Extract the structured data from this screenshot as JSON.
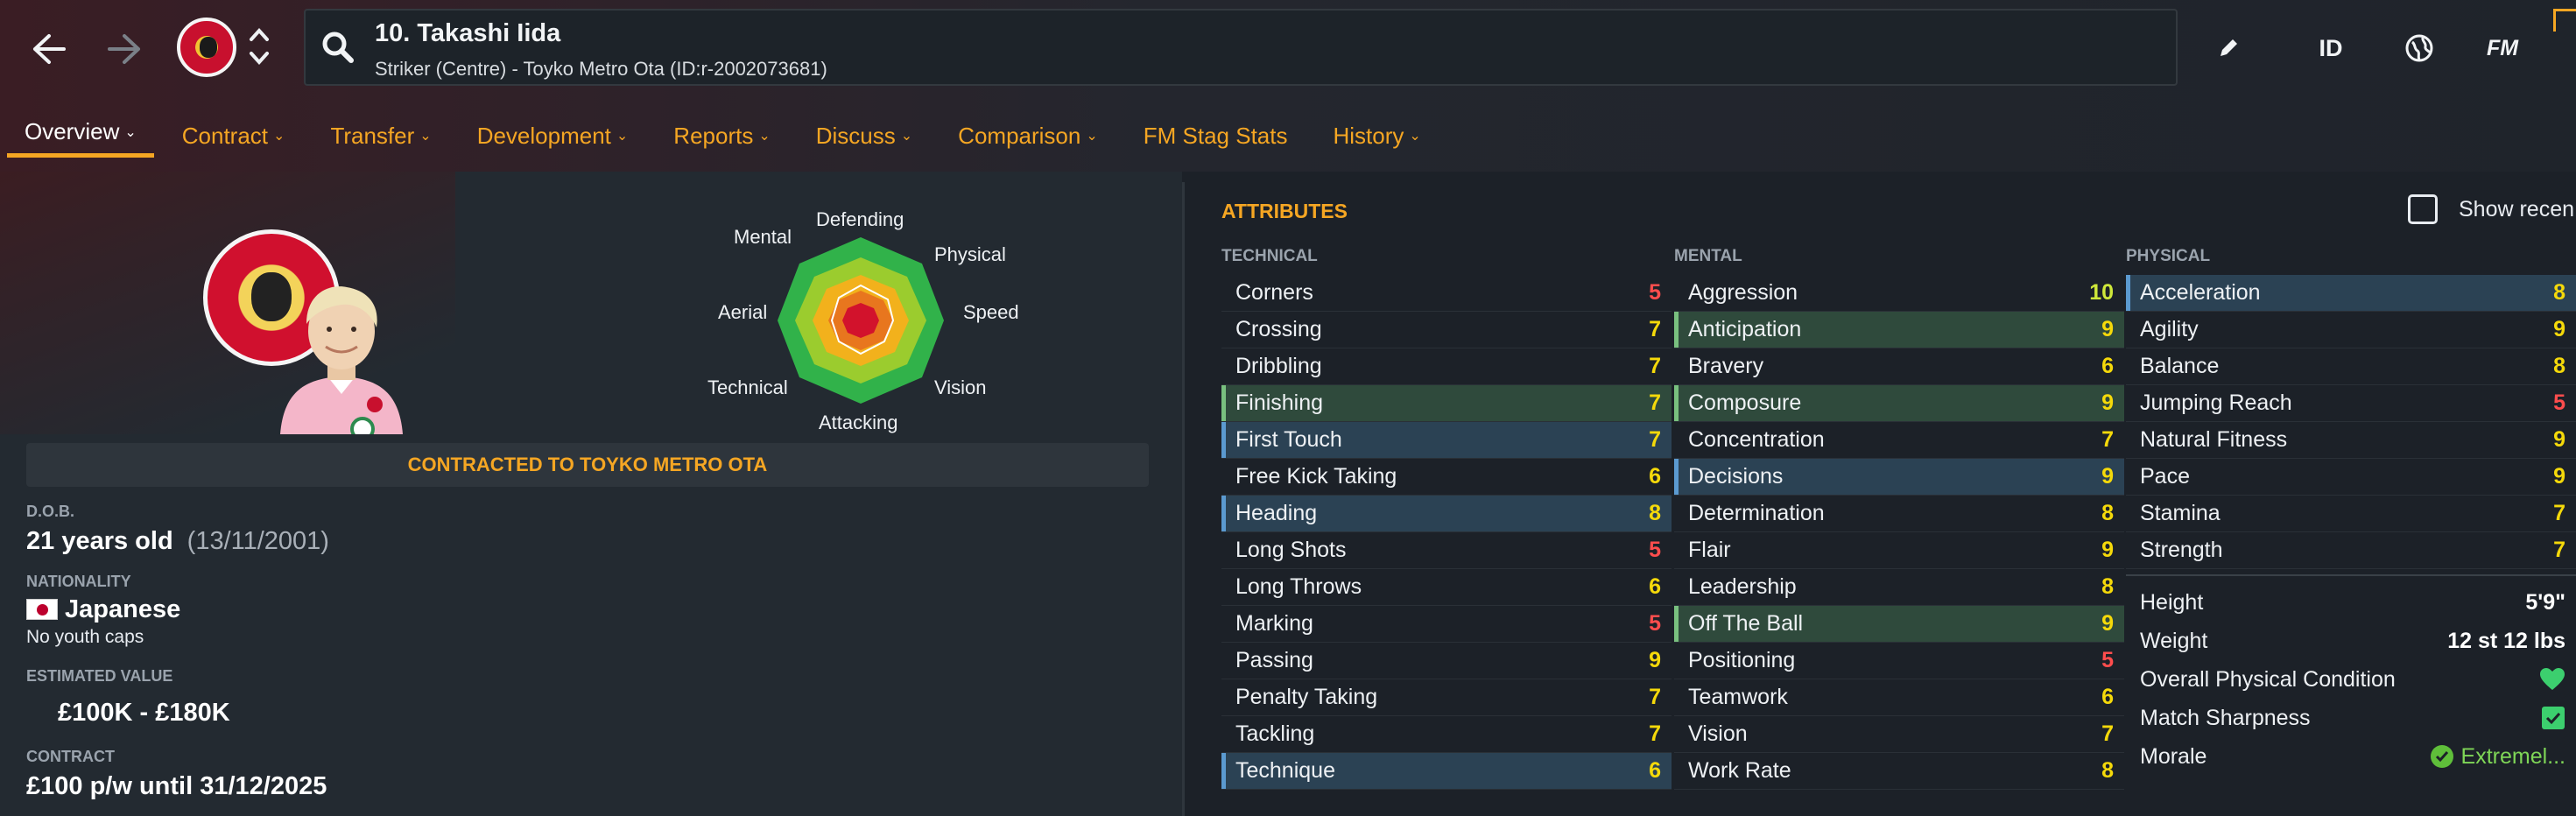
{
  "header": {
    "player_name": "10. Takashi Iida",
    "player_subtitle": "Striker (Centre) - Toyko Metro Ota (ID:r-2002073681)",
    "id_label": "ID",
    "fm_label": "FM",
    "icons": [
      "back-arrow-icon",
      "forward-arrow-icon",
      "search-icon",
      "pencil-icon",
      "globe-icon"
    ]
  },
  "tabs": [
    {
      "label": "Overview",
      "dropdown": true
    },
    {
      "label": "Contract",
      "dropdown": true
    },
    {
      "label": "Transfer",
      "dropdown": true
    },
    {
      "label": "Development",
      "dropdown": true
    },
    {
      "label": "Reports",
      "dropdown": true
    },
    {
      "label": "Discuss",
      "dropdown": true
    },
    {
      "label": "Comparison",
      "dropdown": true
    },
    {
      "label": "FM Stag Stats",
      "dropdown": false
    },
    {
      "label": "History",
      "dropdown": true
    }
  ],
  "radar": {
    "labels": {
      "defending": "Defending",
      "physical": "Physical",
      "speed": "Speed",
      "vision": "Vision",
      "attacking": "Attacking",
      "technical": "Technical",
      "aerial": "Aerial",
      "mental": "Mental"
    }
  },
  "profile": {
    "contract_banner": "CONTRACTED TO TOYKO METRO OTA",
    "dob_label": "D.O.B.",
    "age": "21 years old",
    "dob": "(13/11/2001)",
    "nationality_label": "NATIONALITY",
    "nationality": "Japanese",
    "youth_caps": "No youth caps",
    "value_label": "ESTIMATED VALUE",
    "value": "£100K - £180K",
    "contract_label": "CONTRACT",
    "contract": "£100 p/w until 31/12/2025"
  },
  "attributes": {
    "title": "ATTRIBUTES",
    "show_recent": "Show recen",
    "technical": {
      "title": "TECHNICAL",
      "items": [
        {
          "name": "Corners",
          "value": "5"
        },
        {
          "name": "Crossing",
          "value": "7"
        },
        {
          "name": "Dribbling",
          "value": "7"
        },
        {
          "name": "Finishing",
          "value": "7"
        },
        {
          "name": "First Touch",
          "value": "7"
        },
        {
          "name": "Free Kick Taking",
          "value": "6"
        },
        {
          "name": "Heading",
          "value": "8"
        },
        {
          "name": "Long Shots",
          "value": "5"
        },
        {
          "name": "Long Throws",
          "value": "6"
        },
        {
          "name": "Marking",
          "value": "5"
        },
        {
          "name": "Passing",
          "value": "9"
        },
        {
          "name": "Penalty Taking",
          "value": "7"
        },
        {
          "name": "Tackling",
          "value": "7"
        },
        {
          "name": "Technique",
          "value": "6"
        }
      ]
    },
    "mental": {
      "title": "MENTAL",
      "items": [
        {
          "name": "Aggression",
          "value": "10"
        },
        {
          "name": "Anticipation",
          "value": "9"
        },
        {
          "name": "Bravery",
          "value": "6"
        },
        {
          "name": "Composure",
          "value": "9"
        },
        {
          "name": "Concentration",
          "value": "7"
        },
        {
          "name": "Decisions",
          "value": "9"
        },
        {
          "name": "Determination",
          "value": "8"
        },
        {
          "name": "Flair",
          "value": "9"
        },
        {
          "name": "Leadership",
          "value": "8"
        },
        {
          "name": "Off The Ball",
          "value": "9"
        },
        {
          "name": "Positioning",
          "value": "5"
        },
        {
          "name": "Teamwork",
          "value": "6"
        },
        {
          "name": "Vision",
          "value": "7"
        },
        {
          "name": "Work Rate",
          "value": "8"
        }
      ]
    },
    "physical": {
      "title": "PHYSICAL",
      "items": [
        {
          "name": "Acceleration",
          "value": "8"
        },
        {
          "name": "Agility",
          "value": "9"
        },
        {
          "name": "Balance",
          "value": "8"
        },
        {
          "name": "Jumping Reach",
          "value": "5"
        },
        {
          "name": "Natural Fitness",
          "value": "9"
        },
        {
          "name": "Pace",
          "value": "9"
        },
        {
          "name": "Stamina",
          "value": "7"
        },
        {
          "name": "Strength",
          "value": "7"
        }
      ],
      "height_label": "Height",
      "height": "5'9\"",
      "weight_label": "Weight",
      "weight": "12 st 12 lbs",
      "condition_label": "Overall Physical Condition",
      "sharpness_label": "Match Sharpness",
      "morale_label": "Morale",
      "morale": "Extremel..."
    }
  },
  "colors": {
    "accent": "#f5a623",
    "low": "#ff4d4d",
    "mid": "#f5d90a",
    "high": "#cfe83a",
    "highlight_blue": "#2b4254",
    "highlight_green": "#2f4a3c",
    "status_green": "#3ccf6e"
  }
}
